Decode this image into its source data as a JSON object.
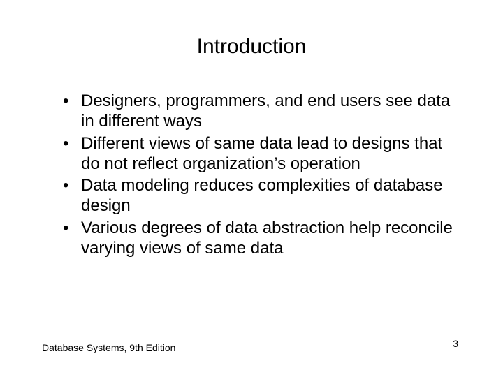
{
  "title": "Introduction",
  "bullets": [
    "Designers, programmers, and end users see data in different ways",
    "Different views of same data lead to designs that do not reflect organization’s operation",
    "Data modeling reduces complexities of database design",
    "Various degrees of data abstraction help reconcile varying views of same data"
  ],
  "footer_left": "Database Systems, 9th Edition",
  "page_number": "3"
}
